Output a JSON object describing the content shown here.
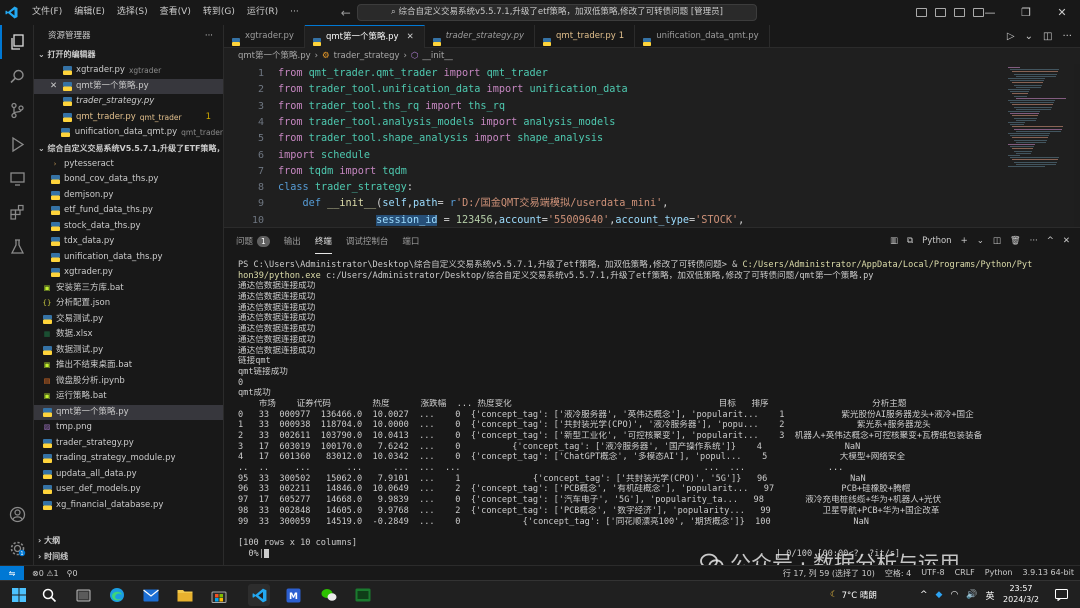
{
  "titlebar": {
    "menus": [
      "文件(F)",
      "编辑(E)",
      "选择(S)",
      "查看(V)",
      "转到(G)",
      "运行(R)"
    ],
    "search_text": "综合自定义交易系统v5.5.7.1,升级了etf策略，加双低策略,修改了可转债问题 [管理员]"
  },
  "sidebar": {
    "title": "资源管理器",
    "open_editors_header": "打开的编辑器",
    "open_editors": [
      {
        "name": "xgtrader.py",
        "desc": "xgtrader",
        "icon": "python-file-icon"
      },
      {
        "name": "qmt第一个策略.py",
        "desc": "",
        "icon": "python-file-icon",
        "selected": true,
        "close": true
      },
      {
        "name": "trader_strategy.py",
        "desc": "",
        "icon": "python-file-icon",
        "italic": true
      },
      {
        "name": "qmt_trader.py",
        "desc": "qmt_trader",
        "icon": "python-file-icon",
        "modified": true,
        "badge": "1"
      },
      {
        "name": "unification_data_qmt.py",
        "desc": "qmt_trader",
        "icon": "python-file-icon"
      }
    ],
    "folder_header": "综合自定义交易系统V5.5.7.1,升级了ETF策略，加...",
    "files": [
      {
        "name": "pytesseract",
        "type": "folder",
        "indent": 1
      },
      {
        "name": "bond_cov_data_ths.py",
        "type": "py",
        "indent": 1
      },
      {
        "name": "demjson.py",
        "type": "py",
        "indent": 1
      },
      {
        "name": "etf_fund_data_ths.py",
        "type": "py",
        "indent": 1
      },
      {
        "name": "stock_data_ths.py",
        "type": "py",
        "indent": 1
      },
      {
        "name": "tdx_data.py",
        "type": "py",
        "indent": 1
      },
      {
        "name": "unification_data_ths.py",
        "type": "py",
        "indent": 1
      },
      {
        "name": "xgtrader.py",
        "type": "py",
        "indent": 1
      },
      {
        "name": "安装第三方库.bat",
        "type": "bat",
        "indent": 0
      },
      {
        "name": "分析配置.json",
        "type": "json",
        "indent": 0
      },
      {
        "name": "交易测试.py",
        "type": "py",
        "indent": 0
      },
      {
        "name": "数据.xlsx",
        "type": "xlsx",
        "indent": 0
      },
      {
        "name": "数据测试.py",
        "type": "py",
        "indent": 0
      },
      {
        "name": "推出不结束桌面.bat",
        "type": "bat",
        "indent": 0
      },
      {
        "name": "微盘股分析.ipynb",
        "type": "ipynb",
        "indent": 0
      },
      {
        "name": "运行策略.bat",
        "type": "bat",
        "indent": 0
      },
      {
        "name": "qmt第一个策略.py",
        "type": "py",
        "indent": 0,
        "selected": true
      },
      {
        "name": "tmp.png",
        "type": "png",
        "indent": 0
      },
      {
        "name": "trader_strategy.py",
        "type": "py",
        "indent": 0
      },
      {
        "name": "trading_strategy_module.py",
        "type": "py",
        "indent": 0
      },
      {
        "name": "updata_all_data.py",
        "type": "py",
        "indent": 0
      },
      {
        "name": "user_def_models.py",
        "type": "py",
        "indent": 0
      },
      {
        "name": "xg_financial_database.py",
        "type": "py",
        "indent": 0
      }
    ],
    "outline_header": "大纲",
    "timeline_header": "时间线"
  },
  "tabs": [
    {
      "label": "xgtrader.py",
      "active": false
    },
    {
      "label": "qmt第一个策略.py",
      "active": true
    },
    {
      "label": "trader_strategy.py",
      "active": false,
      "italic": true
    },
    {
      "label": "qmt_trader.py",
      "active": false,
      "modified": true,
      "count": "1"
    },
    {
      "label": "unification_data_qmt.py",
      "active": false
    }
  ],
  "breadcrumb": [
    "qmt第一个策略.py",
    "trader_strategy",
    "__init__"
  ],
  "code_lines": [
    {
      "n": "1",
      "tokens": [
        [
          "kw",
          "from "
        ],
        [
          "mod",
          "qmt_trader.qmt_trader"
        ],
        [
          "kw",
          " import "
        ],
        [
          "mod",
          "qmt_trader"
        ]
      ]
    },
    {
      "n": "2",
      "tokens": [
        [
          "kw",
          "from "
        ],
        [
          "mod",
          "trader_tool.unification_data"
        ],
        [
          "kw",
          " import "
        ],
        [
          "mod",
          "unification_data"
        ]
      ]
    },
    {
      "n": "3",
      "tokens": [
        [
          "kw",
          "from "
        ],
        [
          "mod",
          "trader_tool.ths_rq"
        ],
        [
          "kw",
          " import "
        ],
        [
          "mod",
          "ths_rq"
        ]
      ]
    },
    {
      "n": "4",
      "tokens": [
        [
          "kw",
          "from "
        ],
        [
          "mod",
          "trader_tool.analysis_models"
        ],
        [
          "kw",
          " import "
        ],
        [
          "mod",
          "analysis_models"
        ]
      ]
    },
    {
      "n": "5",
      "tokens": [
        [
          "kw",
          "from "
        ],
        [
          "mod",
          "trader_tool.shape_analysis"
        ],
        [
          "kw",
          " import "
        ],
        [
          "mod",
          "shape_analysis"
        ]
      ]
    },
    {
      "n": "6",
      "tokens": [
        [
          "kw",
          "import "
        ],
        [
          "mod",
          "schedule"
        ]
      ]
    },
    {
      "n": "7",
      "tokens": [
        [
          "kw",
          "from "
        ],
        [
          "mod",
          "tqdm"
        ],
        [
          "kw",
          " import "
        ],
        [
          "mod",
          "tqdm"
        ]
      ]
    },
    {
      "n": "8",
      "tokens": [
        [
          "kd",
          "class "
        ],
        [
          "mod",
          "trader_strategy"
        ],
        [
          "pl",
          ":"
        ]
      ]
    },
    {
      "n": "9",
      "tokens": [
        [
          "pl",
          "    "
        ],
        [
          "kd",
          "def "
        ],
        [
          "fn",
          "__init__"
        ],
        [
          "pl",
          "("
        ],
        [
          "var",
          "self"
        ],
        [
          "pl",
          ","
        ],
        [
          "var",
          "path"
        ],
        [
          "pl",
          "= "
        ],
        [
          "kd",
          "r"
        ],
        [
          "str",
          "'D:/国金QMT交易端模拟/userdata_mini'"
        ],
        [
          "pl",
          ","
        ]
      ]
    },
    {
      "n": "10",
      "tokens": [
        [
          "pl",
          "                "
        ],
        [
          "hlvar",
          "session_id"
        ],
        [
          "pl",
          " = "
        ],
        [
          "num",
          "123456"
        ],
        [
          "pl",
          ","
        ],
        [
          "var",
          "account"
        ],
        [
          "pl",
          "="
        ],
        [
          "str",
          "'55009640'"
        ],
        [
          "pl",
          ","
        ],
        [
          "var",
          "account_type"
        ],
        [
          "pl",
          "="
        ],
        [
          "str",
          "'STOCK'"
        ],
        [
          "pl",
          ","
        ]
      ]
    }
  ],
  "panel": {
    "tabs": [
      "问题",
      "输出",
      "终端",
      "调试控制台",
      "端口"
    ],
    "problems_count": "1",
    "active_tab": "终端",
    "shell": "Python"
  },
  "terminal_lines": [
    {
      "t": "PS C:\\Users\\Administrator\\Desktop\\综合自定义交易系统v5.5.7.1,升级了etf策略，加双低策略,修改了可转债问题> & ",
      "p": "C:/Users/Administrator/AppData/Local/Programs/Python/Pyt"
    },
    {
      "t": "",
      "p": "hon39/python.exe",
      "t2": " c:/Users/Administrator/Desktop/综合自定义交易系统v5.5.7.1,升级了etf策略，加双低策略,修改了可转债问题/qmt第一个策略.py"
    },
    {
      "t": "通达信数据连接成功"
    },
    {
      "t": "通达信数据连接成功"
    },
    {
      "t": "通达信数据连接成功"
    },
    {
      "t": "通达信数据连接成功"
    },
    {
      "t": "通达信数据连接成功"
    },
    {
      "t": "通达信数据连接成功"
    },
    {
      "t": "通达信数据连接成功"
    },
    {
      "t": "链接qmt"
    },
    {
      "t": "qmt链接成功"
    },
    {
      "t": "0"
    },
    {
      "t": "qmt成功"
    },
    {
      "t": "    市场    证券代码        热度      涨跌幅  ... 热度变化                                        目标   排序                    分析主题"
    },
    {
      "t": "0   33  000977  136466.0  10.0027  ...    0  {'concept_tag': ['液冷服务器', '英伟达概念'], 'popularit...    1           紫光股份AI服务器龙头+液冷+国企"
    },
    {
      "t": "1   33  000938  118704.0  10.0000  ...    0  {'concept_tag': ['共封装光学(CPO)', '液冷服务器'], 'popu...    2              紫光系+服务器龙头"
    },
    {
      "t": "2   33  002611  103790.0  10.0413  ...    0  {'concept_tag': ['新型工业化', '可控核聚变'], 'popularit...    3  机器人+英伟达概念+可控核聚变+瓦楞纸包装装备"
    },
    {
      "t": "3   17  603019  100170.0   7.6242  ...    0          {'concept_tag': ['液冷服务器', '国产操作系统']}    4                NaN"
    },
    {
      "t": "4   17  601360   83012.0  10.0342  ...    0  {'concept_tag': ['ChatGPT概念', '多模态AI'], 'popul...    5              大模型+网络安全"
    },
    {
      "t": "..  ..     ...       ...      ...  ...  ...                                               ...  ...                ..."
    },
    {
      "t": "95  33  300502   15062.0   7.9101  ...    1              {'concept_tag': ['共封装光学(CPO)', '5G']}   96                NaN"
    },
    {
      "t": "96  33  002211   14846.0  10.0649  ...    2  {'concept_tag': ['PCB概念', '有机硅概念'], 'popularit...   97             PCB+硅橡胶+腾帽"
    },
    {
      "t": "97  17  605277   14668.0   9.9839  ...    0  {'concept_tag': ['汽车电子', '5G'], 'popularity_ta...   98        液冷充电桩线缆+华为+机器人+光伏"
    },
    {
      "t": "98  33  002848   14605.0   9.9768  ...    2  {'concept_tag': ['PCB概念', '数字经济'], 'popularity...   99          卫星导航+PCB+华为+国企改革"
    },
    {
      "t": "99  33  300059   14519.0  -0.2849  ...    0            {'concept_tag': ['同花顺漂亮100', '期货概念']}  100                NaN"
    },
    {
      "t": ""
    },
    {
      "t": "[100 rows x 10 columns]"
    },
    {
      "t": "  0%|",
      "cursor": true,
      "tail": "                                                                                                  | 0/100 [00:00<?, ?it/s]"
    }
  ],
  "watermark": "公众号 · 数据分析与运用",
  "statusbar": {
    "problems": "⊗0 ⚠1",
    "ports": "⚲0",
    "position": "行 17, 列 59 (选择了 10)",
    "spaces": "空格: 4",
    "encoding": "UTF-8",
    "eol": "CRLF",
    "language": "Python",
    "interpreter": "3.9.13 64-bit"
  },
  "taskbar": {
    "weather": "7°C  晴朗",
    "ime": "英",
    "time": "23:57",
    "date": "2024/3/2"
  },
  "colors": {
    "accent": "#0078d4",
    "editor_bg": "#1f1f1f",
    "panel_bg": "#181818"
  }
}
